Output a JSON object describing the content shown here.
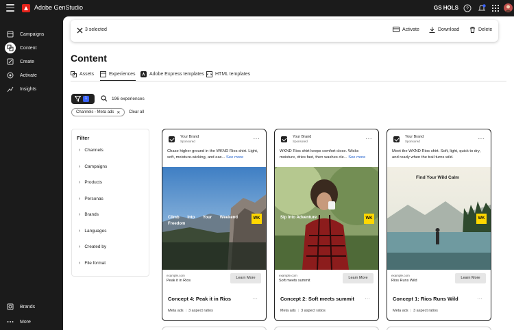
{
  "topbar": {
    "app_name": "Adobe GenStudio",
    "org_name": "GS HOLS",
    "notification_count": "1"
  },
  "sidebar": {
    "items": [
      {
        "label": "Campaigns",
        "icon": "campaigns-icon"
      },
      {
        "label": "Content",
        "icon": "content-icon",
        "active": true
      },
      {
        "label": "Create",
        "icon": "create-icon"
      },
      {
        "label": "Activate",
        "icon": "activate-icon"
      },
      {
        "label": "Insights",
        "icon": "insights-icon"
      }
    ],
    "bottom": [
      {
        "label": "Brands",
        "icon": "brands-icon"
      },
      {
        "label": "More",
        "icon": "more-icon"
      }
    ]
  },
  "actionbar": {
    "selected_text": "3 selected",
    "activate_label": "Activate",
    "download_label": "Download",
    "delete_label": "Delete"
  },
  "page_title": "Content",
  "tabs": [
    {
      "label": "Assets"
    },
    {
      "label": "Experiences",
      "active": true
    },
    {
      "label": "Adobe Express templates"
    },
    {
      "label": "HTML templates"
    }
  ],
  "filter_bar": {
    "filter_count": "1",
    "experience_count": "196 experiences",
    "chip_label": "Channels - Meta ads",
    "clear_all": "Clear all"
  },
  "filter_panel": {
    "heading": "Filter",
    "items": [
      "Channels",
      "Campaigns",
      "Products",
      "Personas",
      "Brands",
      "Languages",
      "Created by",
      "File format"
    ]
  },
  "cards": [
    {
      "brand": "Your Brand",
      "sponsored": "Sponsored",
      "copy": "Chase higher ground in the WKND Rios shirt. Light, soft, moisture-wicking, and eas...",
      "see_more": "See more",
      "overlay": "Climb Into Your Weekend Freedom",
      "logo": "WK",
      "site": "example.com",
      "headline": "Peak it in Rios",
      "cta": "Learn More",
      "title": "Concept 4: Peak it in Rios",
      "channel": "Meta ads",
      "ratios": "3 aspect ratios"
    },
    {
      "brand": "Your Brand",
      "sponsored": "Sponsored",
      "copy": "WKND Rios shirt keeps comfort close. Wicks moisture, dries fast, then washes cle...",
      "see_more": "See more",
      "overlay": "Sip Into Adventure",
      "logo": "WK",
      "site": "example.com",
      "headline": "Soft meets summit",
      "cta": "Learn More",
      "title": "Concept 2: Soft meets summit",
      "channel": "Meta ads",
      "ratios": "3 aspect ratios"
    },
    {
      "brand": "Your Brand",
      "sponsored": "Sponsored",
      "copy": "Meet the WKND Rios shirt. Soft, light, quick to dry, and ready when the trail turns wild.",
      "see_more": "",
      "overlay": "Find Your Wild Calm",
      "logo": "WK",
      "site": "example.com",
      "headline": "Rios Runs Wild",
      "cta": "Learn More",
      "title": "Concept 1: Rios Runs Wild",
      "channel": "Meta ads",
      "ratios": "3 aspect ratios"
    }
  ]
}
